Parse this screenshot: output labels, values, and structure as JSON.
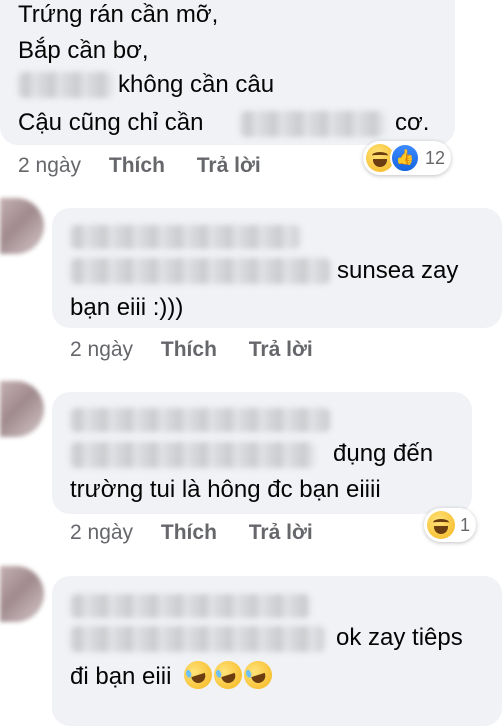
{
  "comment1": {
    "lines": [
      "Trứng rán cần mỡ,",
      "Bắp cần bơ,",
      "không cần câu",
      "Cậu cũng chỉ cần",
      "cơ."
    ],
    "time": "2 ngày",
    "like": "Thích",
    "reply": "Trả lời",
    "reactions": {
      "icons": [
        "haha-icon",
        "like-icon"
      ],
      "count": "12"
    }
  },
  "comment2": {
    "line1_end": "sunsea zay",
    "line2": "bạn eiii :)))",
    "time": "2 ngày",
    "like": "Thích",
    "reply": "Trả lời"
  },
  "comment3": {
    "line1_end": "đụng đến",
    "line2": "trường tui là hông đc bạn eiiii",
    "time": "2 ngày",
    "like": "Thích",
    "reply": "Trả lời",
    "reactions": {
      "icons": [
        "haha-icon"
      ],
      "count": "1"
    }
  },
  "comment4": {
    "line1_end": "ok zay tiêps",
    "line2": "đi bạn eiii"
  }
}
